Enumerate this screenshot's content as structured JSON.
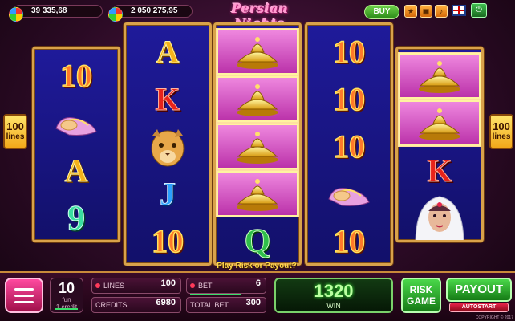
{
  "header": {
    "balance_left": "39 335,68",
    "balance_right": "2 050 275,95",
    "title": "Persian Nights",
    "buy_label": "BUY",
    "icons": [
      "star-icon",
      "screen-icon",
      "sound-icon",
      "info-icon",
      "uk-flag-icon",
      "exit-icon"
    ]
  },
  "side": {
    "lines_number": "100",
    "lines_label": "lines"
  },
  "reels": [
    [
      "10",
      "slippers",
      "A",
      "9"
    ],
    [
      "A",
      "K",
      "lion",
      "J",
      "10"
    ],
    [
      "lamp",
      "lamp",
      "lamp",
      "lamp",
      "Q"
    ],
    [
      "10",
      "10",
      "10",
      "slippers",
      "10"
    ],
    [
      "lamp",
      "lamp",
      "K",
      "woman"
    ]
  ],
  "prompt": "Play Risk or Payout?",
  "footer": {
    "lines_count": "10",
    "lines_sub1": "fun",
    "lines_sub2": "1 credit",
    "lines_label": "LINES",
    "lines_value": "100",
    "bet_label": "BET",
    "bet_value": "6",
    "credits_label": "CREDITS",
    "credits_value": "6980",
    "total_bet_label": "TOTAL BET",
    "total_bet_value": "300",
    "win_amount": "1320",
    "win_label": "WIN",
    "risk_line1": "RISK",
    "risk_line2": "GAME",
    "payout_label": "PAYOUT",
    "autostart_label": "AUTOSTART",
    "copyright": "COPYRIGHT © 2017"
  }
}
